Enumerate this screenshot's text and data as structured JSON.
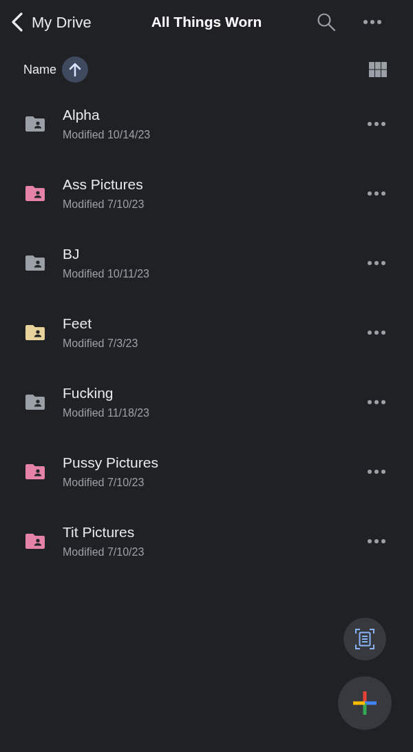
{
  "header": {
    "back_label": "My Drive",
    "title": "All Things Worn"
  },
  "sort": {
    "label": "Name"
  },
  "folders": [
    {
      "name": "Alpha",
      "modified": "Modified 10/14/23",
      "color": "#9aa0a6"
    },
    {
      "name": "Ass Pictures",
      "modified": "Modified 7/10/23",
      "color": "#e583a6"
    },
    {
      "name": "BJ",
      "modified": "Modified 10/11/23",
      "color": "#9aa0a6"
    },
    {
      "name": "Feet",
      "modified": "Modified 7/3/23",
      "color": "#e8d39c"
    },
    {
      "name": "Fucking",
      "modified": "Modified 11/18/23",
      "color": "#9aa0a6"
    },
    {
      "name": "Pussy Pictures",
      "modified": "Modified 7/10/23",
      "color": "#e583a6"
    },
    {
      "name": "Tit Pictures",
      "modified": "Modified 7/10/23",
      "color": "#e583a6"
    }
  ]
}
